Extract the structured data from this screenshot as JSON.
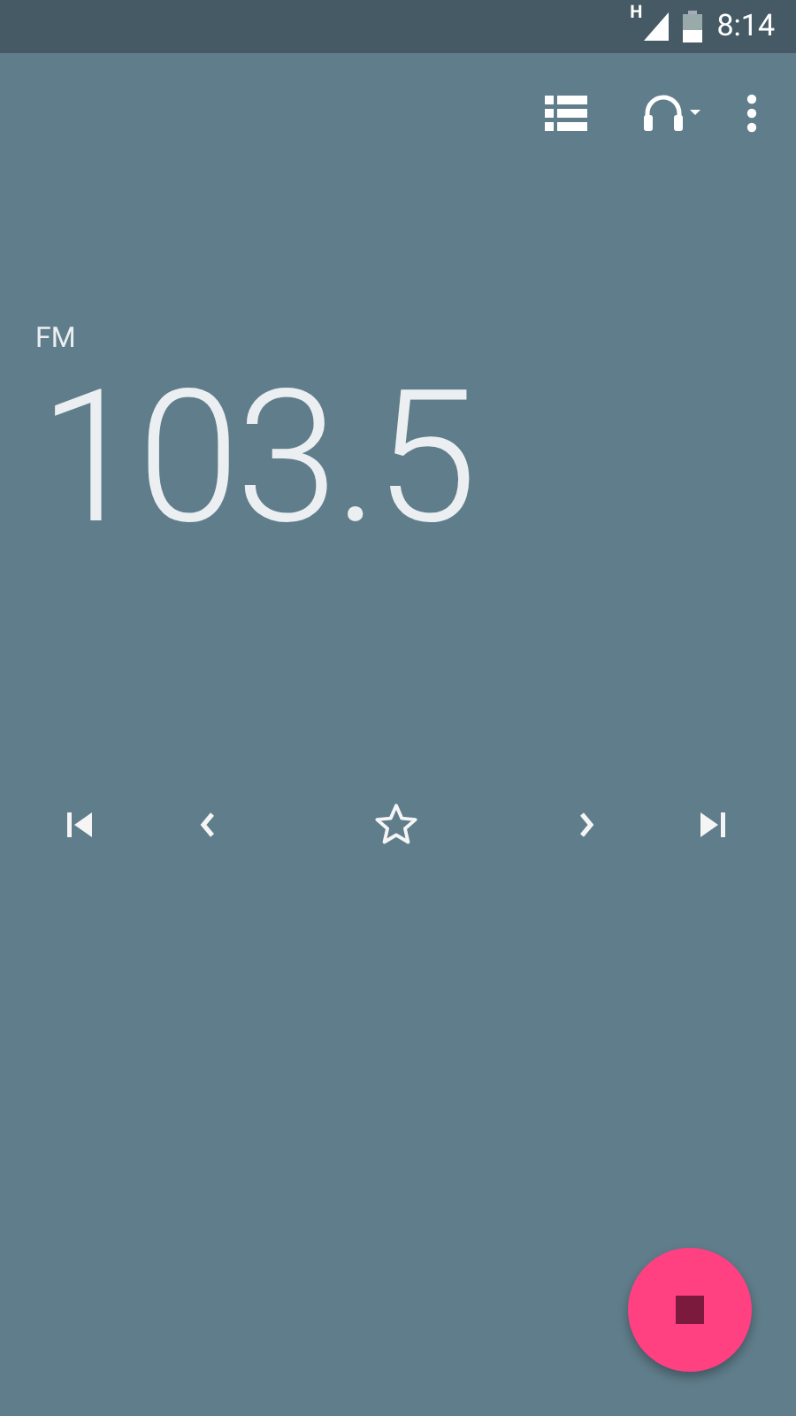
{
  "status_bar": {
    "network": "H",
    "time": "8:14"
  },
  "station": {
    "band": "FM",
    "frequency": "103.5"
  },
  "controls": {
    "favorite": false
  }
}
